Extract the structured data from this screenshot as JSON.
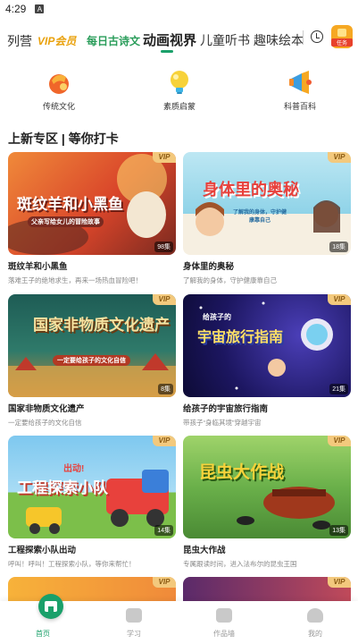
{
  "status_bar": {
    "time": "4:29",
    "icon": "A"
  },
  "top_nav": {
    "tabs": [
      {
        "label": "列营"
      },
      {
        "label": "VIP会员"
      },
      {
        "label": "每日古诗文"
      },
      {
        "label": "动画视界"
      },
      {
        "label": "儿童听书"
      },
      {
        "label": "趣味绘本"
      }
    ],
    "active_tab": "动画视界",
    "gift_label": "任务"
  },
  "categories": [
    {
      "label": "传统文化",
      "icon": "traditional-culture-icon"
    },
    {
      "label": "素质启蒙",
      "icon": "lightbulb-icon"
    },
    {
      "label": "科普百科",
      "icon": "megaphone-icon"
    }
  ],
  "section": {
    "title": "上新专区 | 等你打卡"
  },
  "cards": [
    {
      "title": "斑纹羊和小黑鱼",
      "desc": "落难王子的绝地求生，再来一场热血冒险吧！",
      "episodes": "98集",
      "badge": "VIP",
      "img_title": "斑纹羊和小黑鱼",
      "img_subtitle": "父亲写给女儿的冒险故事"
    },
    {
      "title": "身体里的奥秘",
      "desc": "了解我的身体，守护健康靠自己",
      "episodes": "18集",
      "badge": "VIP",
      "img_title": "身体里的奥秘",
      "img_subtitle": "了解我的身体，守护健康靠自己"
    },
    {
      "title": "国家非物质文化遗产",
      "desc": "一定要给孩子的文化自信",
      "episodes": "8集",
      "badge": "VIP",
      "img_title": "国家非物质文化遗产",
      "img_subtitle": "一定要给孩子的文化自信"
    },
    {
      "title": "给孩子的宇宙旅行指南",
      "desc": "带孩子“身临其境”穿越宇宙",
      "episodes": "21集",
      "badge": "VIP",
      "img_title": "宇宙旅行指南",
      "img_subtitle": "给孩子的"
    },
    {
      "title": "工程探索小队出动",
      "desc": "呼叫！呼叫！工程探索小队，等你来帮忙！",
      "episodes": "14集",
      "badge": "VIP",
      "img_title": "工程探索小队",
      "img_subtitle": "出动!"
    },
    {
      "title": "昆虫大作战",
      "desc": "专属跟读时间，进入法布尔的昆虫王国",
      "episodes": "13集",
      "badge": "VIP",
      "img_title": "昆虫大作战",
      "img_subtitle": ""
    }
  ],
  "peek_cards": [
    {
      "badge": "VIP"
    },
    {
      "badge": "VIP"
    }
  ],
  "bottom_nav": [
    {
      "label": "首页",
      "active": true
    },
    {
      "label": "学习",
      "active": false
    },
    {
      "label": "作品墙",
      "active": false
    },
    {
      "label": "我的",
      "active": false
    }
  ],
  "colors": {
    "accent": "#1aa06a",
    "vip": "#f3c97d"
  }
}
